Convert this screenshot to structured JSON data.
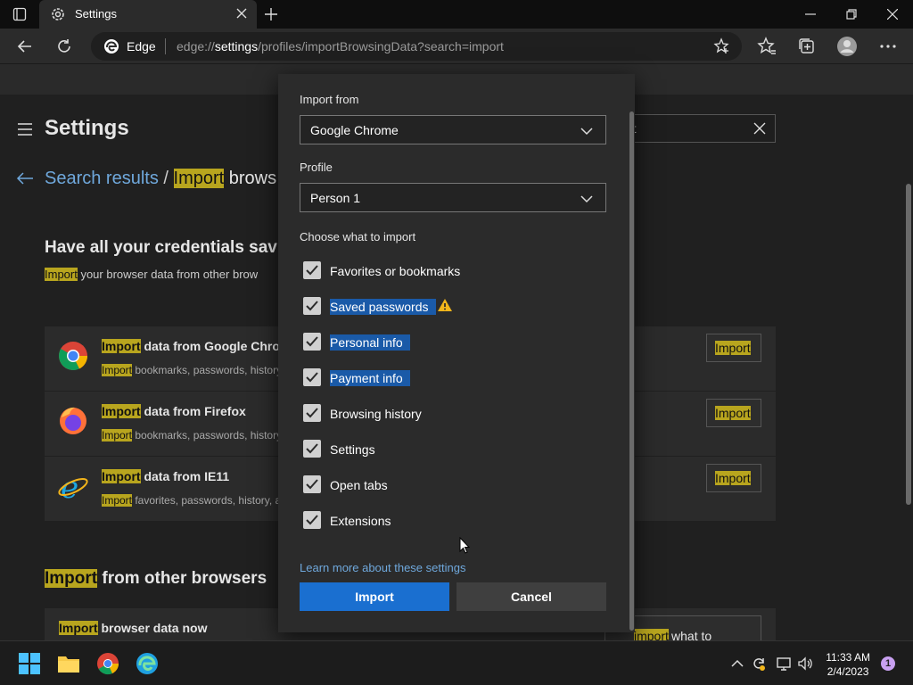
{
  "browser": {
    "tab_title": "Settings",
    "omnibox_label": "Edge",
    "url_prefix": "edge://",
    "url_host": "settings",
    "url_path": "/profiles/importBrowsingData?search=import"
  },
  "settings_page": {
    "title": "Settings",
    "search_value": "rt",
    "breadcrumb_link": "Search results",
    "breadcrumb_sep": "/",
    "breadcrumb_hl": "Import",
    "breadcrumb_rest": " brows",
    "heading": "Have all your credentials sav",
    "sub_hl": "Import",
    "sub_rest": " your browser data from other brow",
    "cards": [
      {
        "title_hl": "Import",
        "title_rest": " data from Google Chron",
        "desc_hl": "Import",
        "desc_rest": " bookmarks, passwords, history",
        "button": "Import"
      },
      {
        "title_hl": "Import",
        "title_rest": " data from Firefox",
        "desc_hl": "Import",
        "desc_rest": " bookmarks, passwords, history",
        "button": "Import"
      },
      {
        "title_hl": "Import",
        "title_rest": " data from IE11",
        "desc_hl": "Import",
        "desc_rest": " favorites, passwords, history, a",
        "button": "Import"
      }
    ],
    "section_hl": "Import",
    "section_rest": " from other browsers",
    "row_hl": "Import",
    "row_rest": " browser data now",
    "row_button_pre": "hoose what to ",
    "row_button_hl": "import"
  },
  "dialog": {
    "import_from_label": "Import from",
    "import_from_value": "Google Chrome",
    "profile_label": "Profile",
    "profile_value": "Person 1",
    "choose_label": "Choose what to import",
    "items": [
      {
        "label": "Favorites or bookmarks",
        "checked": true
      },
      {
        "label": "Saved passwords",
        "checked": true
      },
      {
        "label": "Personal info",
        "checked": true
      },
      {
        "label": "Payment info",
        "checked": true
      },
      {
        "label": "Browsing history",
        "checked": true
      },
      {
        "label": "Settings",
        "checked": true
      },
      {
        "label": "Open tabs",
        "checked": true
      },
      {
        "label": "Extensions",
        "checked": true
      }
    ],
    "learn_more": "Learn more about these settings",
    "import_button": "Import",
    "cancel_button": "Cancel"
  },
  "taskbar": {
    "time": "11:33 AM",
    "date": "2/4/2023",
    "notification_count": "1"
  },
  "colors": {
    "accent": "#1a6fd0",
    "link": "#6fa8dc",
    "search_highlight": "#b8a51e",
    "selection": "#1a5aa8",
    "warning": "#f2b61b"
  }
}
